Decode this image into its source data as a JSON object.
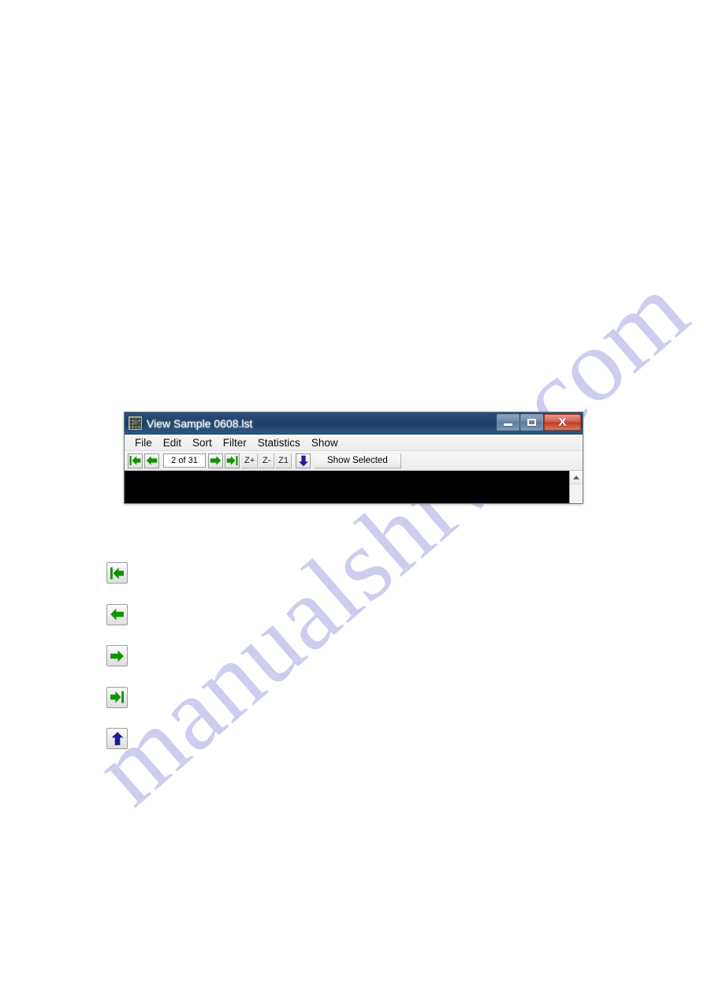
{
  "page": {
    "watermark": "manualshive.com",
    "background_color": "#ffffff",
    "watermark_color": "#c9c9ee"
  },
  "window": {
    "title": "View  Sample 0608.lst",
    "app_icon": "spectrum-grid-icon",
    "accent_colors": {
      "titlebar_blue": "#1c3f66",
      "close_red": "#bf3a22",
      "arrow_green": "#0f9400",
      "arrow_blue": "#1c1c96"
    },
    "controls": {
      "minimize": {
        "name": "minimize-button",
        "glyph": "minimize-icon"
      },
      "maximize": {
        "name": "maximize-button",
        "glyph": "maximize-icon"
      },
      "close": {
        "name": "close-button",
        "label": "X",
        "glyph": "close-icon"
      }
    },
    "menu": {
      "items": [
        {
          "label": "File",
          "name": "menu-file"
        },
        {
          "label": "Edit",
          "name": "menu-edit"
        },
        {
          "label": "Sort",
          "name": "menu-sort"
        },
        {
          "label": "Filter",
          "name": "menu-filter"
        },
        {
          "label": "Statistics",
          "name": "menu-statistics"
        },
        {
          "label": "Show",
          "name": "menu-show"
        }
      ]
    },
    "toolbar": {
      "first_button": {
        "icon": "first-record-arrow-left-icon"
      },
      "prev_button": {
        "icon": "previous-record-arrow-left-icon"
      },
      "page_indicator": {
        "value": "2 of 31",
        "current": 2,
        "total": 31
      },
      "next_button": {
        "icon": "next-record-arrow-right-icon"
      },
      "last_button": {
        "icon": "last-record-arrow-right-icon"
      },
      "zoom_in": {
        "label": "Z+"
      },
      "zoom_out": {
        "label": "Z-"
      },
      "zoom_reset": {
        "label": "Z1"
      },
      "down_button": {
        "icon": "blue-down-arrow-icon"
      },
      "show_selected": {
        "label": "Show Selected"
      }
    },
    "content": {
      "background_color": "#000000",
      "scrollbar": {
        "up_arrow": "scroll-up-arrow-icon"
      }
    }
  },
  "icon_legend": {
    "items": [
      {
        "name": "icon-first-record",
        "icon": "first-record-arrow-left-icon",
        "direction": "left",
        "bar": "left",
        "color": "#0f9400"
      },
      {
        "name": "icon-previous-record",
        "icon": "previous-record-arrow-left-icon",
        "direction": "left",
        "bar": "none",
        "color": "#0f9400"
      },
      {
        "name": "icon-next-record",
        "icon": "next-record-arrow-right-icon",
        "direction": "right",
        "bar": "none",
        "color": "#0f9400"
      },
      {
        "name": "icon-last-record",
        "icon": "last-record-arrow-right-icon",
        "direction": "right",
        "bar": "right",
        "color": "#0f9400"
      },
      {
        "name": "icon-up",
        "icon": "blue-up-arrow-icon",
        "direction": "up",
        "bar": "none",
        "color": "#1c1c96"
      }
    ]
  }
}
